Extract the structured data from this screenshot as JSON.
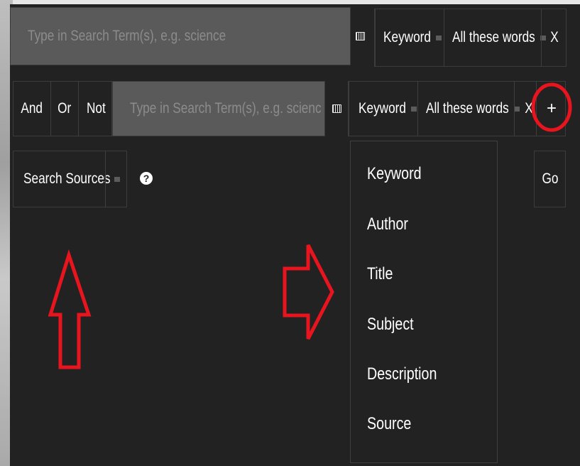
{
  "row1": {
    "search_placeholder": "Type in Search Term(s), e.g. science",
    "field_label": "Keyword",
    "match_label": "All these words",
    "remove_label": "X"
  },
  "row2": {
    "bool_and": "And",
    "bool_or": "Or",
    "bool_not": "Not",
    "search_placeholder": "Type in Search Term(s), e.g. scienc",
    "field_label": "Keyword",
    "match_label": "All these words",
    "remove_label": "X",
    "add_label": "+"
  },
  "sources": {
    "label": "Search Sources",
    "help_symbol": "?"
  },
  "go_label": "Go",
  "field_menu": {
    "items": [
      "Keyword",
      "Author",
      "Title",
      "Subject",
      "Description",
      "Source"
    ]
  },
  "annotation_color": "#e8141e",
  "icons": [
    "keyboard-icon",
    "dropdown-indicator-icon",
    "help-icon",
    "up-arrow-annotation",
    "right-arrow-annotation",
    "circle-annotation"
  ]
}
